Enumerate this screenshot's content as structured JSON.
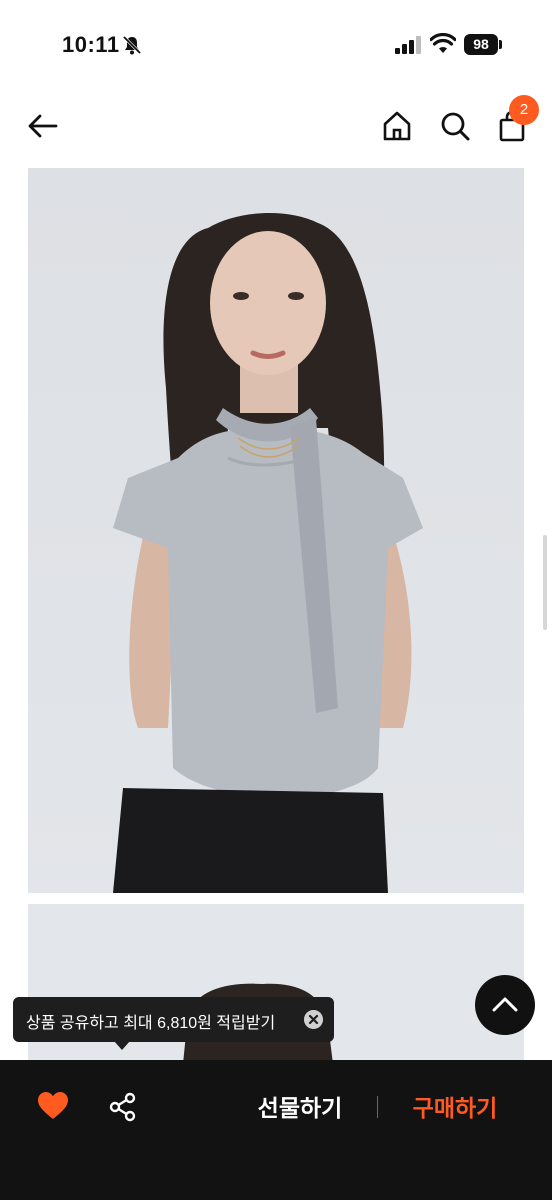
{
  "status_bar": {
    "time": "10:11",
    "battery": "98"
  },
  "header": {
    "cart_count": "2"
  },
  "tooltip": {
    "text": "상품 공유하고 최대 6,810원 적립받기"
  },
  "bottom_bar": {
    "gift_label": "선물하기",
    "buy_label": "구매하기"
  },
  "icons": {
    "back": "arrow-left-icon",
    "home": "home-icon",
    "search": "search-icon",
    "cart": "shopping-bag-icon",
    "like": "heart-icon",
    "share": "share-icon",
    "scroll_top": "chevron-up-icon",
    "close": "close-icon"
  },
  "colors": {
    "accent": "#ff5a1f",
    "bottom_bar_bg": "#121212",
    "tooltip_bg": "#1e1e1e"
  }
}
